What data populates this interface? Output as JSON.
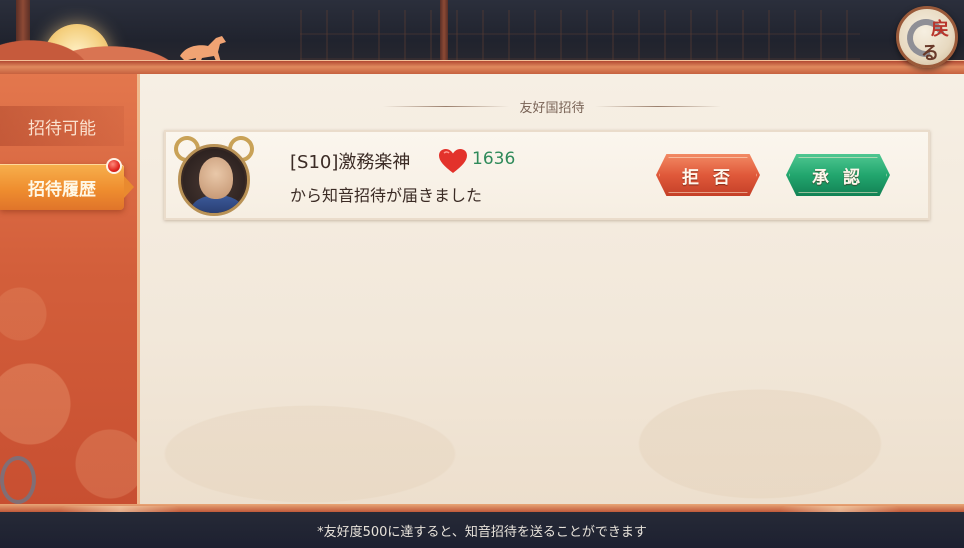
{
  "sidebar": {
    "tabs": [
      {
        "label": "招待可能"
      },
      {
        "label": "招待履歴"
      }
    ],
    "active_tab": "招待履歴"
  },
  "main": {
    "section_title": "友好国招待",
    "invites": [
      {
        "player_name": "[S10]激務楽神",
        "friendship": "1636",
        "message": "から知音招待が届きました",
        "reject_label": "拒 否",
        "accept_label": "承 認"
      }
    ]
  },
  "corner_badge": {
    "glyph_top": "戻",
    "glyph_bottom": "る"
  },
  "footer": {
    "note": "*友好度500に達すると、知音招待を送ることができます"
  },
  "colors": {
    "accent_orange": "#d35f3b",
    "active_tab": "#ef8e2f",
    "reject_red": "#e0593a",
    "accept_green": "#22a66e",
    "score_green": "#2f8a5a"
  },
  "icons": [
    "horse-icon",
    "heart-icon",
    "return-icon",
    "notification-dot"
  ]
}
